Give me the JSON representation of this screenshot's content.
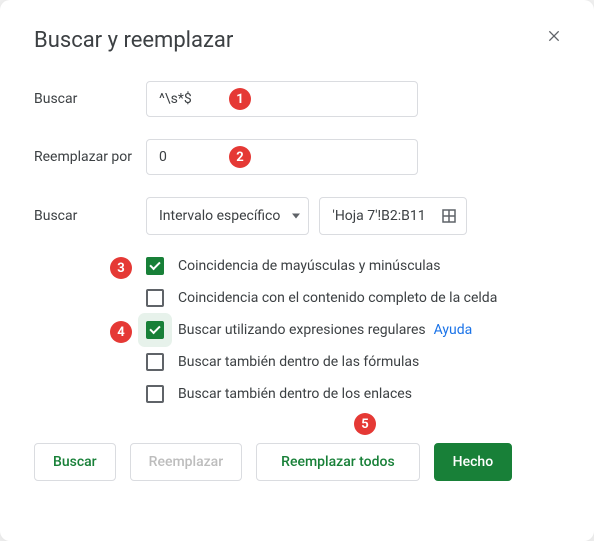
{
  "dialog": {
    "title": "Buscar y reemplazar",
    "labels": {
      "find": "Buscar",
      "replace": "Reemplazar por",
      "search_scope": "Buscar"
    },
    "find_value": "^\\s*$",
    "replace_value": "0",
    "scope": {
      "dropdown_selected": "Intervalo específico",
      "range_text": "'Hoja 7'!B2:B11"
    },
    "options": {
      "match_case": {
        "label": "Coincidencia de mayúsculas y minúsculas",
        "checked": true
      },
      "entire_cell": {
        "label": "Coincidencia con el contenido completo de la celda",
        "checked": false
      },
      "regex": {
        "label": "Buscar utilizando expresiones regulares",
        "checked": true,
        "help": "Ayuda"
      },
      "in_formulas": {
        "label": "Buscar también dentro de las fórmulas",
        "checked": false
      },
      "in_links": {
        "label": "Buscar también dentro de los enlaces",
        "checked": false
      }
    },
    "buttons": {
      "find": "Buscar",
      "replace": "Reemplazar",
      "replace_all": "Reemplazar todos",
      "done": "Hecho"
    }
  },
  "callouts": {
    "1": "1",
    "2": "2",
    "3": "3",
    "4": "4",
    "5": "5"
  }
}
